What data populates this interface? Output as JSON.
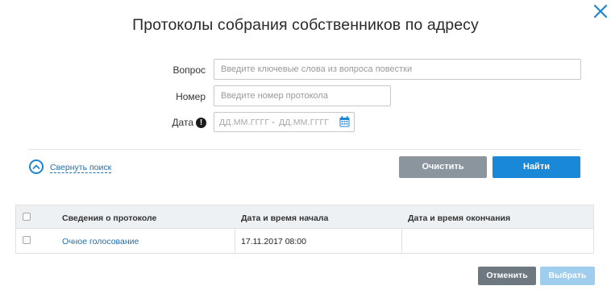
{
  "modal": {
    "title": "Протоколы собрания собственников по адресу"
  },
  "search": {
    "question_label": "Вопрос",
    "question_placeholder": "Введите ключевые слова из вопроса повестки",
    "number_label": "Номер",
    "number_placeholder": "Введите номер протокола",
    "date_label": "Дата",
    "date_from_placeholder": "ДД.ММ.ГГГГ",
    "date_separator": "-",
    "date_to_placeholder": "ДД.ММ.ГГГГ",
    "collapse_label": "Свернуть поиск",
    "clear_label": "Очистить",
    "find_label": "Найти"
  },
  "table": {
    "columns": [
      "Сведения о протоколе",
      "Дата и время начала",
      "Дата и время окончания"
    ],
    "rows": [
      {
        "info": "Очное голосование",
        "start": "17.11.2017 08:00",
        "end": ""
      }
    ]
  },
  "footer": {
    "cancel_label": "Отменить",
    "select_label": "Выбрать"
  },
  "icons": {
    "close": "close-icon",
    "info": "info-icon",
    "calendar": "calendar-icon",
    "collapse": "chevron-up-icon"
  },
  "colors": {
    "primary": "#1988d6",
    "secondary": "#8a959e",
    "link": "#1d6fb0",
    "disabled": "#9fcdee"
  }
}
